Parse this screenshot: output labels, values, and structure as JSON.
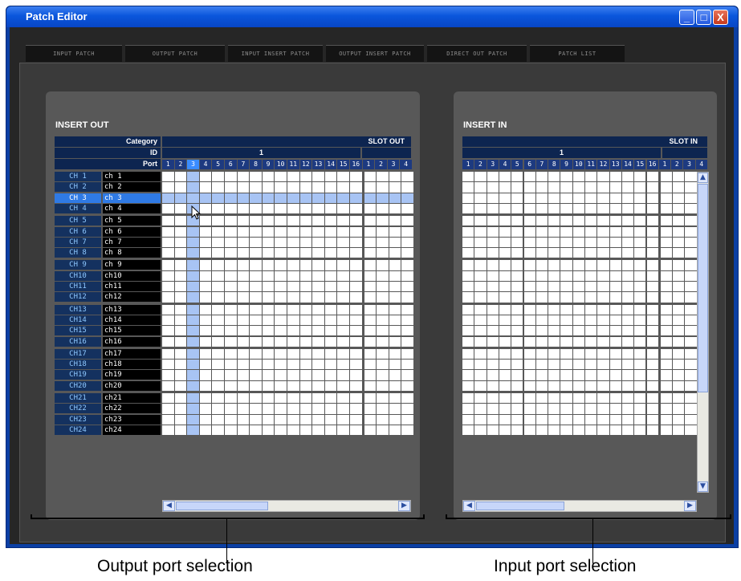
{
  "window": {
    "title": "Patch Editor"
  },
  "window_buttons": {
    "minimize": "_",
    "maximize": "□",
    "close": "X"
  },
  "tabs": [
    {
      "label": "INPUT PATCH",
      "active": false
    },
    {
      "label": "OUTPUT PATCH",
      "active": false
    },
    {
      "label": "INPUT INSERT PATCH",
      "active": true
    },
    {
      "label": "OUTPUT INSERT PATCH",
      "active": false
    },
    {
      "label": "DIRECT OUT PATCH",
      "active": false
    },
    {
      "label": "PATCH LIST",
      "active": false
    }
  ],
  "insert_out": {
    "title": "INSERT OUT",
    "category_label": "Category",
    "id_label": "ID",
    "port_label": "Port",
    "category": "SLOT OUT",
    "id": "1",
    "ports": [
      "1",
      "2",
      "3",
      "4",
      "5",
      "6",
      "7",
      "8",
      "9",
      "10",
      "11",
      "12",
      "13",
      "14",
      "15",
      "16",
      "1",
      "2",
      "3",
      "4"
    ],
    "selected_port": "3",
    "selected_port_index": 2
  },
  "insert_in": {
    "title": "INSERT IN",
    "category": "SLOT IN",
    "id": "1",
    "ports": [
      "1",
      "2",
      "3",
      "4",
      "5",
      "6",
      "7",
      "8",
      "9",
      "10",
      "11",
      "12",
      "13",
      "14",
      "15",
      "16",
      "1",
      "2",
      "3",
      "4"
    ]
  },
  "channels": [
    {
      "name": "CH 1",
      "label": "ch 1"
    },
    {
      "name": "CH 2",
      "label": "ch 2"
    },
    {
      "name": "CH 3",
      "label": "ch 3"
    },
    {
      "name": "CH 4",
      "label": "ch 4"
    },
    {
      "name": "CH 5",
      "label": "ch 5"
    },
    {
      "name": "CH 6",
      "label": "ch 6"
    },
    {
      "name": "CH 7",
      "label": "ch 7"
    },
    {
      "name": "CH 8",
      "label": "ch 8"
    },
    {
      "name": "CH 9",
      "label": "ch 9"
    },
    {
      "name": "CH10",
      "label": "ch10"
    },
    {
      "name": "CH11",
      "label": "ch11"
    },
    {
      "name": "CH12",
      "label": "ch12"
    },
    {
      "name": "CH13",
      "label": "ch13"
    },
    {
      "name": "CH14",
      "label": "ch14"
    },
    {
      "name": "CH15",
      "label": "ch15"
    },
    {
      "name": "CH16",
      "label": "ch16"
    },
    {
      "name": "CH17",
      "label": "ch17"
    },
    {
      "name": "CH18",
      "label": "ch18"
    },
    {
      "name": "CH19",
      "label": "ch19"
    },
    {
      "name": "CH20",
      "label": "ch20"
    },
    {
      "name": "CH21",
      "label": "ch21"
    },
    {
      "name": "CH22",
      "label": "ch22"
    },
    {
      "name": "CH23",
      "label": "ch23"
    },
    {
      "name": "CH24",
      "label": "ch24"
    }
  ],
  "selected_channel": "CH 3",
  "selected_channel_index": 2,
  "icons": {
    "scroll_left": "◀",
    "scroll_right": "▶",
    "scroll_up": "▲",
    "scroll_down": "▼",
    "cursor": "arrow-cursor-icon"
  },
  "colors": {
    "selection": "#2f7ae5",
    "selection_light": "#a8c4f4",
    "title_bar": "#0a56dc"
  },
  "captions": {
    "left": "Output port selection",
    "right": "Input port selection"
  }
}
